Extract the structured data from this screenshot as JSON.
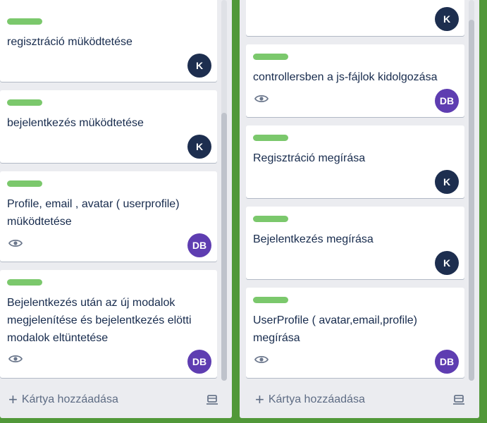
{
  "board": {
    "background": "#519839",
    "label_color": "#7bc86c"
  },
  "left_list": {
    "cards": [
      {
        "title": "",
        "avatar": "K"
      },
      {
        "title": "regisztráció müködtetése",
        "avatar": "K"
      },
      {
        "title": "bejelentkezés müködtetése",
        "avatar": "K"
      },
      {
        "title": "Profile, email , avatar ( userprofile) müködtetése",
        "avatar": "DB",
        "watching": true
      },
      {
        "title": "Bejelentkezés után az új modalok megjelenítése és bejelentkezés elötti modalok eltüntetése",
        "avatar": "DB",
        "watching": true
      }
    ],
    "add_card_label": "Kártya hozzáadása"
  },
  "right_list": {
    "cards": [
      {
        "title": "",
        "avatar": "K"
      },
      {
        "title": "controllersben a js-fájlok kidolgozása",
        "avatar": "DB",
        "watching": true
      },
      {
        "title": "Regisztráció megírása",
        "avatar": "K"
      },
      {
        "title": "Bejelentkezés megírása",
        "avatar": "K"
      },
      {
        "title": "UserProfile ( avatar,email,profile) megírása",
        "avatar": "DB",
        "watching": true
      }
    ],
    "add_card_label": "Kártya hozzáadása"
  }
}
